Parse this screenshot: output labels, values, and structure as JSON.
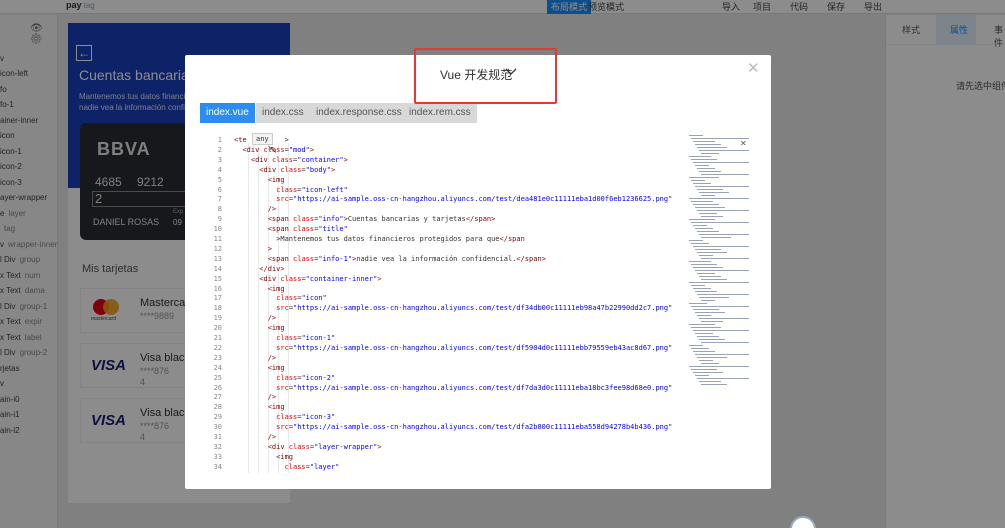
{
  "topbar": {
    "app_name": "pay",
    "app_tag": "tag",
    "modes": [
      "布局模式",
      "预览模式"
    ],
    "actions": [
      "导入",
      "项目",
      "代码",
      "保存",
      "导出"
    ]
  },
  "left_tree": [
    {
      "label": "",
      "sub": ""
    },
    {
      "label": "v",
      "sub": ""
    },
    {
      "label": "icon-left",
      "sub": ""
    },
    {
      "label": "fo",
      "sub": ""
    },
    {
      "label": "fo-1",
      "sub": ""
    },
    {
      "label": "ainer-inner",
      "sub": ""
    },
    {
      "label": "icon",
      "sub": ""
    },
    {
      "label": "icon-1",
      "sub": ""
    },
    {
      "label": "icon-2",
      "sub": ""
    },
    {
      "label": "icon-3",
      "sub": ""
    },
    {
      "label": "ayer-wrapper",
      "sub": ""
    },
    {
      "label": "e",
      "sub": "layer"
    },
    {
      "label": "",
      "sub": "tag"
    },
    {
      "label": "v",
      "sub": "wrapper-inner"
    },
    {
      "label": "l Div",
      "sub": "group"
    },
    {
      "label": "x Text",
      "sub": "num"
    },
    {
      "label": "x Text",
      "sub": "dama"
    },
    {
      "label": "l Div",
      "sub": "group-1"
    },
    {
      "label": "x Text",
      "sub": "expir"
    },
    {
      "label": "x Text",
      "sub": "label"
    },
    {
      "label": "l Div",
      "sub": "group-2"
    },
    {
      "label": "rjetas",
      "sub": ""
    },
    {
      "label": "v",
      "sub": ""
    },
    {
      "label": "ain-i0",
      "sub": ""
    },
    {
      "label": "ain-i1",
      "sub": ""
    },
    {
      "label": "ain-i2",
      "sub": ""
    }
  ],
  "phone": {
    "title": "Cuentas bancarias y tarjetas",
    "subtitle_1": "Mantenemos tus datos financieros protegidos para que",
    "subtitle_2": "nadie vea la información confidencial.",
    "card": {
      "brand": "BBVA",
      "number": [
        "4685",
        "9212"
      ],
      "seq": "2",
      "holder": "DANIEL ROSAS",
      "exp_label": "Exp",
      "exp": "09"
    },
    "section_title": "Mis tarjetas",
    "cards": [
      {
        "logo": "mastercard",
        "logo_text": "mastercard",
        "name": "Mastercard",
        "number": "****9889",
        "exp": ""
      },
      {
        "logo": "visa",
        "logo_text": "VISA",
        "name": "Visa black",
        "number": "****876",
        "exp": "4"
      },
      {
        "logo": "visa",
        "logo_text": "VISA",
        "name": "Visa black",
        "number": "****876",
        "exp": "4"
      }
    ]
  },
  "right_panel": {
    "tabs": [
      "样式",
      "属性",
      "事件"
    ],
    "active_tab": "属性",
    "hint": "请先选中组件"
  },
  "modal": {
    "title": "Vue 开发规范",
    "tabs": [
      "index.vue",
      "index.css",
      "index.response.css",
      "index.rem.css"
    ],
    "active_tab": "index.vue",
    "tooltip": "any",
    "code_lines": [
      {
        "n": "1",
        "indent": 0,
        "parts": [
          [
            "tag",
            "<te"
          ],
          [
            "txt",
            "         "
          ],
          [
            "tag",
            ">"
          ]
        ]
      },
      {
        "n": "2",
        "indent": 1,
        "parts": [
          [
            "tag",
            "<div "
          ],
          [
            "attr",
            "class"
          ],
          [
            "txt",
            "="
          ],
          [
            "val",
            "\"mod\""
          ],
          [
            "tag",
            ">"
          ]
        ]
      },
      {
        "n": "3",
        "indent": 2,
        "parts": [
          [
            "tag",
            "<div "
          ],
          [
            "attr",
            "class"
          ],
          [
            "txt",
            "="
          ],
          [
            "val",
            "\"container\""
          ],
          [
            "tag",
            ">"
          ]
        ]
      },
      {
        "n": "4",
        "indent": 3,
        "parts": [
          [
            "tag",
            "<div "
          ],
          [
            "attr",
            "class"
          ],
          [
            "txt",
            "="
          ],
          [
            "val",
            "\"body\""
          ],
          [
            "tag",
            ">"
          ]
        ]
      },
      {
        "n": "5",
        "indent": 4,
        "parts": [
          [
            "tag",
            "<img"
          ]
        ]
      },
      {
        "n": "6",
        "indent": 5,
        "parts": [
          [
            "attr",
            "class"
          ],
          [
            "txt",
            "="
          ],
          [
            "val",
            "\"icon-left\""
          ]
        ]
      },
      {
        "n": "7",
        "indent": 5,
        "parts": [
          [
            "attr",
            "src"
          ],
          [
            "txt",
            "="
          ],
          [
            "val",
            "\"https://ai-sample.oss-cn-hangzhou.aliyuncs.com/test/dea481e0c11111eba1d00f6eb1236625.png\""
          ]
        ]
      },
      {
        "n": "8",
        "indent": 4,
        "parts": [
          [
            "tag",
            "/>"
          ]
        ]
      },
      {
        "n": "9",
        "indent": 4,
        "parts": [
          [
            "tag",
            "<span "
          ],
          [
            "attr",
            "class"
          ],
          [
            "txt",
            "="
          ],
          [
            "val",
            "\"info\""
          ],
          [
            "tag",
            ">"
          ],
          [
            "txt",
            "Cuentas bancarias y tarjetas"
          ],
          [
            "tag",
            "</span>"
          ]
        ]
      },
      {
        "n": "10",
        "indent": 4,
        "parts": [
          [
            "tag",
            "<span "
          ],
          [
            "attr",
            "class"
          ],
          [
            "txt",
            "="
          ],
          [
            "val",
            "\"title\""
          ]
        ]
      },
      {
        "n": "11",
        "indent": 5,
        "parts": [
          [
            "tag",
            ">"
          ],
          [
            "txt",
            "Mantenemos tus datos financieros protegidos para que"
          ],
          [
            "tag",
            "</span"
          ]
        ]
      },
      {
        "n": "12",
        "indent": 4,
        "parts": [
          [
            "tag",
            ">"
          ]
        ]
      },
      {
        "n": "13",
        "indent": 4,
        "parts": [
          [
            "tag",
            "<span "
          ],
          [
            "attr",
            "class"
          ],
          [
            "txt",
            "="
          ],
          [
            "val",
            "\"info-1\""
          ],
          [
            "tag",
            ">"
          ],
          [
            "txt",
            "nadie vea la información confidencial."
          ],
          [
            "tag",
            "</span>"
          ]
        ]
      },
      {
        "n": "14",
        "indent": 3,
        "parts": [
          [
            "tag",
            "</div>"
          ]
        ]
      },
      {
        "n": "15",
        "indent": 3,
        "parts": [
          [
            "tag",
            "<div "
          ],
          [
            "attr",
            "class"
          ],
          [
            "txt",
            "="
          ],
          [
            "val",
            "\"container-inner\""
          ],
          [
            "tag",
            ">"
          ]
        ]
      },
      {
        "n": "16",
        "indent": 4,
        "parts": [
          [
            "tag",
            "<img"
          ]
        ]
      },
      {
        "n": "17",
        "indent": 5,
        "parts": [
          [
            "attr",
            "class"
          ],
          [
            "txt",
            "="
          ],
          [
            "val",
            "\"icon\""
          ]
        ]
      },
      {
        "n": "18",
        "indent": 5,
        "parts": [
          [
            "attr",
            "src"
          ],
          [
            "txt",
            "="
          ],
          [
            "val",
            "\"https://ai-sample.oss-cn-hangzhou.aliyuncs.com/test/df34db00c11111eb98a47b22990dd2c7.png\""
          ]
        ]
      },
      {
        "n": "19",
        "indent": 4,
        "parts": [
          [
            "tag",
            "/>"
          ]
        ]
      },
      {
        "n": "20",
        "indent": 4,
        "parts": [
          [
            "tag",
            "<img"
          ]
        ]
      },
      {
        "n": "21",
        "indent": 5,
        "parts": [
          [
            "attr",
            "class"
          ],
          [
            "txt",
            "="
          ],
          [
            "val",
            "\"icon-1\""
          ]
        ]
      },
      {
        "n": "22",
        "indent": 5,
        "parts": [
          [
            "attr",
            "src"
          ],
          [
            "txt",
            "="
          ],
          [
            "val",
            "\"https://ai-sample.oss-cn-hangzhou.aliyuncs.com/test/df5904d0c11111ebb79559eb43ac8d67.png\""
          ]
        ]
      },
      {
        "n": "23",
        "indent": 4,
        "parts": [
          [
            "tag",
            "/>"
          ]
        ]
      },
      {
        "n": "24",
        "indent": 4,
        "parts": [
          [
            "tag",
            "<img"
          ]
        ]
      },
      {
        "n": "25",
        "indent": 5,
        "parts": [
          [
            "attr",
            "class"
          ],
          [
            "txt",
            "="
          ],
          [
            "val",
            "\"icon-2\""
          ]
        ]
      },
      {
        "n": "26",
        "indent": 5,
        "parts": [
          [
            "attr",
            "src"
          ],
          [
            "txt",
            "="
          ],
          [
            "val",
            "\"https://ai-sample.oss-cn-hangzhou.aliyuncs.com/test/df7da3d0c11111eba18bc3fee98d68e0.png\""
          ]
        ]
      },
      {
        "n": "27",
        "indent": 4,
        "parts": [
          [
            "tag",
            "/>"
          ]
        ]
      },
      {
        "n": "28",
        "indent": 4,
        "parts": [
          [
            "tag",
            "<img"
          ]
        ]
      },
      {
        "n": "29",
        "indent": 5,
        "parts": [
          [
            "attr",
            "class"
          ],
          [
            "txt",
            "="
          ],
          [
            "val",
            "\"icon-3\""
          ]
        ]
      },
      {
        "n": "30",
        "indent": 5,
        "parts": [
          [
            "attr",
            "src"
          ],
          [
            "txt",
            "="
          ],
          [
            "val",
            "\"https://ai-sample.oss-cn-hangzhou.aliyuncs.com/test/dfa2b800c11111eba558d94278b4b436.png\""
          ]
        ]
      },
      {
        "n": "31",
        "indent": 4,
        "parts": [
          [
            "tag",
            "/>"
          ]
        ]
      },
      {
        "n": "32",
        "indent": 4,
        "parts": [
          [
            "tag",
            "<div "
          ],
          [
            "attr",
            "class"
          ],
          [
            "txt",
            "="
          ],
          [
            "val",
            "\"layer-wrapper\""
          ],
          [
            "tag",
            ">"
          ]
        ]
      },
      {
        "n": "33",
        "indent": 5,
        "parts": [
          [
            "tag",
            "<img"
          ]
        ]
      },
      {
        "n": "34",
        "indent": 6,
        "parts": [
          [
            "attr",
            "class"
          ],
          [
            "txt",
            "="
          ],
          [
            "val",
            "\"layer\""
          ]
        ]
      }
    ]
  },
  "colors": {
    "accent": "#2d8cf0",
    "highlight_box": "#e53935",
    "banner": "#1b3fbd"
  },
  "icons": {
    "close": "close-icon",
    "chevron": "chevron-down-icon",
    "back": "back-arrow-icon",
    "eye": "eye-icon",
    "gear": "gear-icon"
  }
}
